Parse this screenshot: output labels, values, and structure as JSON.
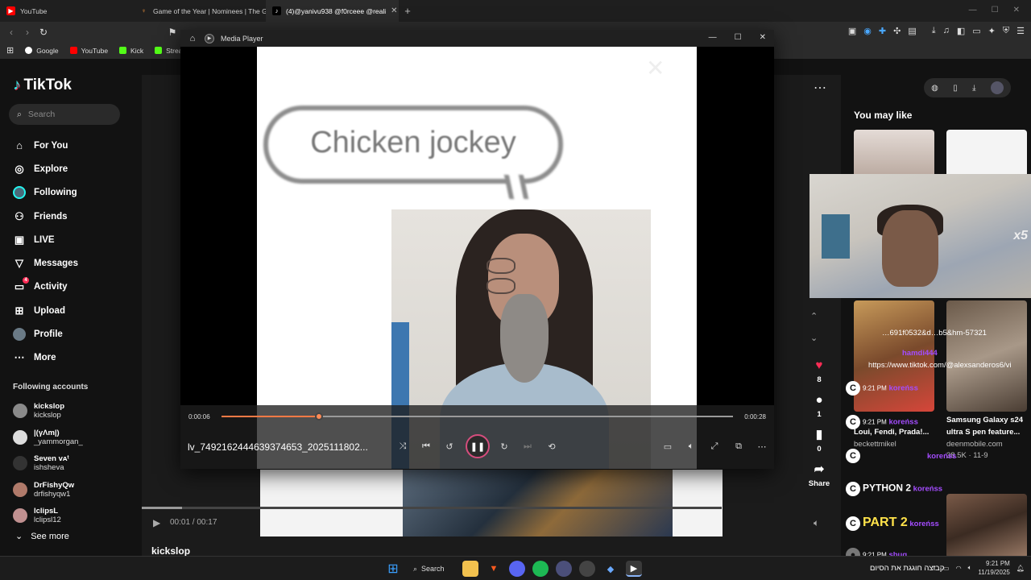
{
  "browser": {
    "tabs": [
      {
        "label": "YouTube",
        "active": false
      },
      {
        "label": "Game of the Year | Nominees | The G",
        "active": false
      },
      {
        "label": "(4)@yanivu938 @f0rceee @reali",
        "active": true
      }
    ],
    "bookmarks": [
      "Google",
      "YouTube",
      "Kick",
      "Stream"
    ]
  },
  "tiktok": {
    "logo": "TikTok",
    "search_placeholder": "Search",
    "nav": [
      {
        "label": "For You",
        "icon": "home-icon"
      },
      {
        "label": "Explore",
        "icon": "compass-icon"
      },
      {
        "label": "Following",
        "icon": "following-avatar-icon"
      },
      {
        "label": "Friends",
        "icon": "friends-icon"
      },
      {
        "label": "LIVE",
        "icon": "live-icon"
      },
      {
        "label": "Messages",
        "icon": "messages-icon"
      },
      {
        "label": "Activity",
        "icon": "activity-icon",
        "badge": "4"
      },
      {
        "label": "Upload",
        "icon": "upload-icon"
      },
      {
        "label": "Profile",
        "icon": "profile-avatar-icon"
      },
      {
        "label": "More",
        "icon": "more-icon"
      }
    ],
    "following_title": "Following accounts",
    "following": [
      {
        "name": "kickslop",
        "handle": "kickslop"
      },
      {
        "name": "|(γΛm|)",
        "handle": "_yammorgan_"
      },
      {
        "name": "Seven ᴠᴀᵗ",
        "handle": "ishsheva"
      },
      {
        "name": "DrFishyQw",
        "handle": "drfishyqw1"
      },
      {
        "name": "lclipsL",
        "handle": "lclipsl12"
      }
    ],
    "see_more": "See more",
    "player_time": "00:01 / 00:17",
    "creator": "kickslop",
    "actions": {
      "likes": "8",
      "comments": "1",
      "saves": "0",
      "share": "Share"
    },
    "you_may_like": "You may like",
    "recs": [
      {
        "title": "Samsung Galaxy s24",
        "title2": "ultra S pen feature...",
        "author": "deenmobile.com",
        "meta": "38.5K · 11-9"
      },
      {
        "title": "Loui, Fendi, Prada!...",
        "author": "beckettmikel"
      }
    ]
  },
  "stream_overlay": {
    "multiplier": "x5"
  },
  "chat": [
    {
      "time": "9:21 PM",
      "user": "koreńss",
      "text": "…691f0532&d…b5&hm-57321"
    },
    {
      "time": "",
      "user": "hamdi444",
      "text": "https://www.tiktok.com/@alexsanderos6/vi"
    },
    {
      "time": "9:21 PM",
      "user": "koreńss",
      "text": ""
    },
    {
      "time": "",
      "user": "koreńss",
      "text": ""
    },
    {
      "time": "9:21 PM",
      "user": "koreńss",
      "text": "PYTHON 2"
    },
    {
      "time": "9:21 PM",
      "user": "koreńss",
      "text": "PART 2"
    },
    {
      "time": "9:21 PM",
      "user": "sbug",
      "text": "קבוצה חוגגת את הסיום"
    }
  ],
  "media_player": {
    "title": "Media Player",
    "video_text": "Chicken jockey",
    "time_elapsed": "0:00:06",
    "time_total": "0:00:28",
    "progress": 0.19,
    "filename": "lv_7492162444639374653_2025111802..."
  },
  "taskbar": {
    "search_label": "Search",
    "time": "9:21 PM",
    "date": "11/19/2025"
  },
  "colors": {
    "accent": "#ff7a45",
    "tiktok_red": "#fe2c55",
    "chat_user": "#a44cff"
  }
}
